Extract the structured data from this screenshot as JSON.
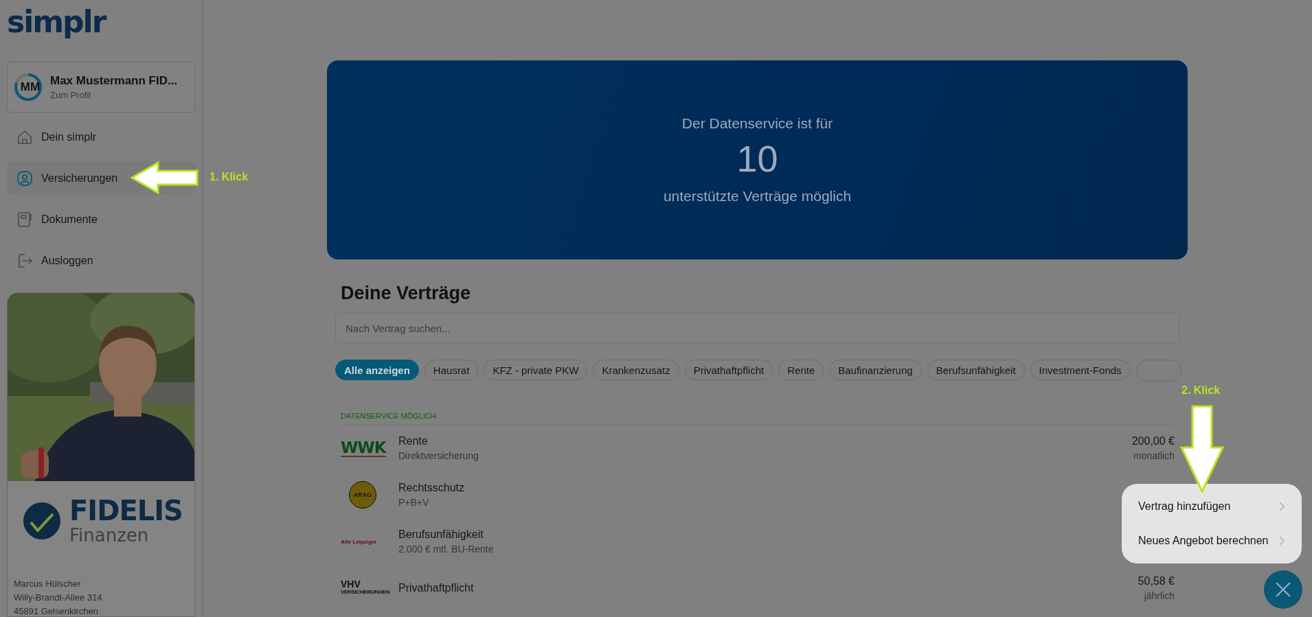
{
  "logo": "simplr",
  "profile": {
    "initials": "MM",
    "name": "Max Mustermann FID...",
    "link": "Zum Profil",
    "level": 0.8
  },
  "nav": [
    {
      "label": "Dein simplr",
      "selected": false
    },
    {
      "label": "Versicherungen",
      "selected": true
    },
    {
      "label": "Dokumente",
      "selected": false
    },
    {
      "label": "Ausloggen",
      "selected": false
    }
  ],
  "advisor": {
    "photo": {
      "kind": "picture"
    },
    "brand": "FIDELIS",
    "brand_sub": "Finanzen",
    "address": [
      "Marcus Hülscher",
      "Willy-Brandt-Allee 314",
      "45891 Gelsenkirchen"
    ]
  },
  "banner": {
    "line1": "Der Datenservice ist für",
    "count": "10",
    "line2": "unterstützte Verträge möglich"
  },
  "heading": "Deine Verträge",
  "search": {
    "placeholder": "Nach Vertrag suchen..."
  },
  "filters": [
    {
      "label": "Alle anzeigen",
      "selected": true
    },
    {
      "label": "Hausrat",
      "selected": false
    },
    {
      "label": "KFZ - private PKW",
      "selected": false
    },
    {
      "label": "Krankenzusatz",
      "selected": false
    },
    {
      "label": "Privathaftpflicht",
      "selected": false
    },
    {
      "label": "Rente",
      "selected": false
    },
    {
      "label": "Baufinanzierung",
      "selected": false
    },
    {
      "label": "Berufsunfähigkeit",
      "selected": false
    },
    {
      "label": "Investment-Fonds",
      "selected": false
    }
  ],
  "section": "DATENSERVICE MÖGLICH",
  "contracts": [
    {
      "logo": "WWK",
      "title": "Rente",
      "subtitle": "Direktversicherung",
      "amount": "200,00 €",
      "period": "monatlich"
    },
    {
      "logo": "ARAG",
      "title": "Rechtsschutz",
      "subtitle": "P+B+V"
    },
    {
      "logo": "Alte Leipziger",
      "title": "Berufsunfähigkeit",
      "subtitle": "2.000 € mtl. BU-Rente"
    },
    {
      "logo": "VHV",
      "logo_sub": "VERSICHERUNGEN",
      "title": "Privathaftpflicht",
      "amount": "50,58 €",
      "period": "jährlich"
    }
  ],
  "menu": [
    {
      "label": "Vertrag hinzufügen"
    },
    {
      "label": "Neues Angebot berechnen"
    }
  ],
  "annotations": [
    {
      "kind": "left",
      "label": "1. Klick"
    },
    {
      "kind": "down",
      "label": "2. Klick"
    }
  ]
}
